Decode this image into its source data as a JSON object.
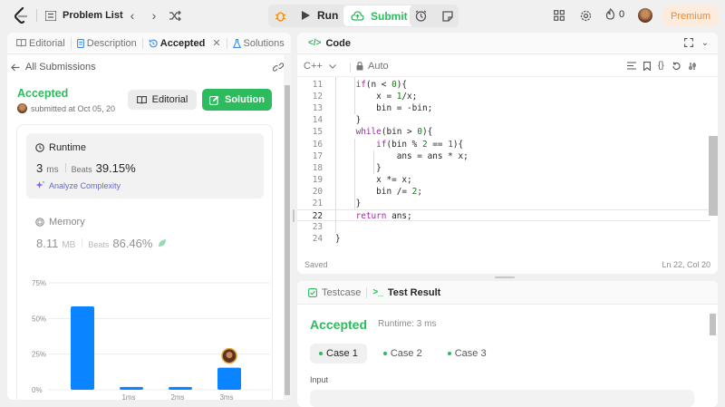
{
  "topbar": {
    "problem_list": "Problem List",
    "run": "Run",
    "submit": "Submit",
    "streak": "0",
    "premium": "Premium"
  },
  "left": {
    "tabs": [
      {
        "label": "Editorial"
      },
      {
        "label": "Description"
      },
      {
        "label": "Accepted"
      },
      {
        "label": "Solutions"
      }
    ],
    "all_submissions": "All Submissions",
    "status": "Accepted",
    "submitted": "submitted at Oct 05, 20",
    "editorial_btn": "Editorial",
    "solution_btn": "Solution",
    "runtime_label": "Runtime",
    "runtime_value": "3",
    "runtime_unit": "ms",
    "beats_label": "Beats",
    "runtime_beats": "39.15%",
    "analyze": "Analyze Complexity",
    "memory_label": "Memory",
    "memory_value": "8.11",
    "memory_unit": "MB",
    "memory_beats": "86.46%"
  },
  "chart_data": {
    "type": "bar",
    "categories": [
      "",
      "1ms",
      "2ms",
      "3ms"
    ],
    "values": [
      58.5,
      2,
      2,
      15.5
    ],
    "ylim": [
      0,
      75
    ],
    "yticks": [
      "0%",
      "25%",
      "50%",
      "75%"
    ],
    "grid": true,
    "highlight_color": "#0a84ff"
  },
  "code": {
    "title": "Code",
    "language": "C++",
    "auto": "Auto",
    "lines": [
      {
        "n": "11",
        "text": "    if(n < 0){"
      },
      {
        "n": "12",
        "text": "        x = 1/x;"
      },
      {
        "n": "13",
        "text": "        bin = -bin;"
      },
      {
        "n": "14",
        "text": "    }"
      },
      {
        "n": "15",
        "text": "    while(bin > 0){"
      },
      {
        "n": "16",
        "text": "        if(bin % 2 == 1){"
      },
      {
        "n": "17",
        "text": "            ans = ans * x;"
      },
      {
        "n": "18",
        "text": "        }"
      },
      {
        "n": "19",
        "text": "        x *= x;"
      },
      {
        "n": "20",
        "text": "        bin /= 2;"
      },
      {
        "n": "21",
        "text": "    }"
      },
      {
        "n": "22",
        "text": "    return ans;"
      },
      {
        "n": "23",
        "text": ""
      },
      {
        "n": "24",
        "text": "}"
      }
    ],
    "saved": "Saved",
    "cursor": "Ln 22, Col 20"
  },
  "result": {
    "tab_testcase": "Testcase",
    "tab_result": "Test Result",
    "status": "Accepted",
    "runtime": "Runtime: 3 ms",
    "cases": [
      "Case 1",
      "Case 2",
      "Case 3"
    ],
    "input_label": "Input"
  }
}
